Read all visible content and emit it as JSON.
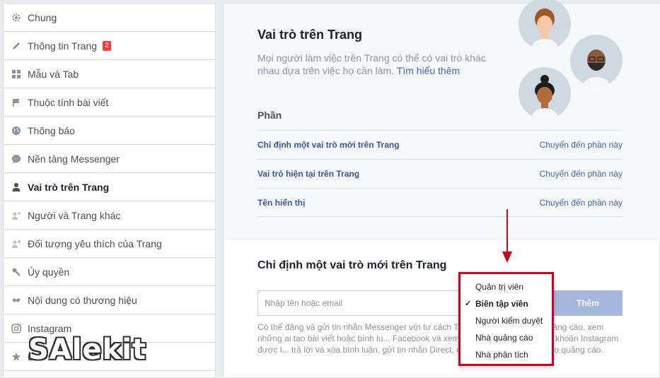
{
  "sidebar": {
    "items": [
      {
        "label": "Chung",
        "icon": "gear-icon"
      },
      {
        "label": "Thông tin Trang",
        "icon": "pencil-icon",
        "badge": "2"
      },
      {
        "label": "Mẫu và Tab",
        "icon": "grid-icon"
      },
      {
        "label": "Thuộc tính bài viết",
        "icon": "flag-icon"
      },
      {
        "label": "Thông báo",
        "icon": "globe-icon"
      },
      {
        "label": "Nền tảng Messenger",
        "icon": "messenger-icon"
      },
      {
        "label": "Vai trò trên Trang",
        "icon": "person-icon",
        "active": true
      },
      {
        "label": "Người và Trang khác",
        "icon": "people-add-icon"
      },
      {
        "label": "Đối tượng yêu thích của Trang",
        "icon": "people-star-icon"
      },
      {
        "label": "Ủy quyền",
        "icon": "wrench-icon"
      },
      {
        "label": "Nội dung có thương hiệu",
        "icon": "handshake-icon"
      },
      {
        "label": "Instagram",
        "icon": "instagram-icon"
      },
      {
        "label": "Đ...",
        "icon": "star-icon"
      }
    ]
  },
  "main": {
    "title": "Vai trò trên Trang",
    "description": "Mọi người làm việc trên Trang có thể có vai trò khác nhau dựa trên việc họ cần làm.",
    "learn_more": "Tìm hiểu thêm",
    "sections_heading": "Phần",
    "sections": [
      {
        "label": "Chỉ định một vai trò mới trên Trang",
        "link": "Chuyển đến phần này"
      },
      {
        "label": "Vai trò hiện tại trên Trang",
        "link": "Chuyển đến phần này"
      },
      {
        "label": "Tên hiển thị",
        "link": "Chuyển đến phần này"
      }
    ],
    "assign_title": "Chỉ định một vai trò mới trên Trang",
    "input_placeholder": "Nhập tên hoặc email",
    "add_button": "Thêm",
    "info_text": "Có thể đăng và gửi tin nhắn Messenger với tư cách T... luận trên Trang, tạo quảng cáo, xem những ai tạo bài viết hoặc bình lu... Facebook và xem thông tin chi tiết. Nếu tài khoản Instagram được l... trả lời và xóa bình luận, gửi tin nhắn Direct, đồng bộ thông tin liên h... o quảng cáo."
  },
  "dropdown": {
    "options": [
      {
        "label": "Quản trị viên",
        "selected": false
      },
      {
        "label": "Biên tập viên",
        "selected": true
      },
      {
        "label": "Người kiểm duyệt",
        "selected": false
      },
      {
        "label": "Nhà quảng cáo",
        "selected": false
      },
      {
        "label": "Nhà phân tích",
        "selected": false
      }
    ],
    "check_mark": "✓"
  },
  "watermark": "SAlekit",
  "colors": {
    "accent": "#4267b2",
    "highlight": "#d0021b",
    "badge": "#fa3e3e"
  }
}
